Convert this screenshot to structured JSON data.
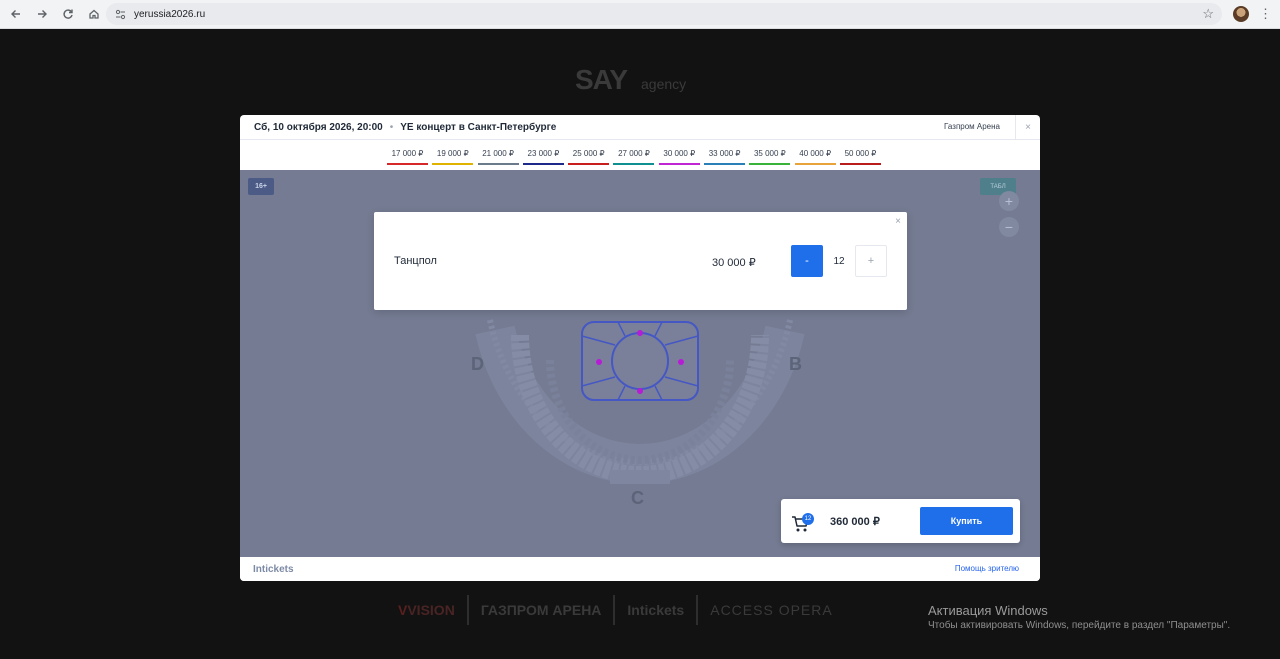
{
  "browser": {
    "url": "yerussia2026.ru",
    "icons": [
      "back-icon",
      "forward-icon",
      "reload-icon",
      "home-icon",
      "site-settings-icon",
      "star-icon",
      "profile-avatar",
      "menu-icon"
    ]
  },
  "background": {
    "logo_main": "SAY",
    "logo_sub": "agency",
    "sponsors": [
      "VISION",
      "ГАЗПРОМ АРЕНА",
      "Intickets",
      "ACCESS OPERA"
    ]
  },
  "modal": {
    "event_date": "Сб, 10 октября 2026, 20:00",
    "separator": "•",
    "event_title": "YE концерт в Санкт-Петербурге",
    "venue": "Газпром Арена",
    "close_glyph": "×",
    "prices": [
      {
        "label": "17 000 ₽",
        "color": "#d62828"
      },
      {
        "label": "19 000 ₽",
        "color": "#e0b300"
      },
      {
        "label": "21 000 ₽",
        "color": "#6b7b8c"
      },
      {
        "label": "23 000 ₽",
        "color": "#1d2a8a"
      },
      {
        "label": "25 000 ₽",
        "color": "#c81e1e"
      },
      {
        "label": "27 000 ₽",
        "color": "#0f8f8f"
      },
      {
        "label": "30 000 ₽",
        "color": "#c026d3"
      },
      {
        "label": "33 000 ₽",
        "color": "#2a7fb8"
      },
      {
        "label": "35 000 ₽",
        "color": "#3bb33b"
      },
      {
        "label": "40 000 ₽",
        "color": "#e8a33a"
      },
      {
        "label": "50 000 ₽",
        "color": "#b91c1c"
      }
    ],
    "map": {
      "age_badge": "16+",
      "zoom_badge": "ТАБЛ",
      "zoom_in": "+",
      "zoom_out": "−",
      "sectors": [
        "D",
        "B",
        "C"
      ]
    },
    "popup": {
      "zone": "Танцпол",
      "price": "30 000 ₽",
      "minus": "-",
      "quantity": "12",
      "plus": "+"
    },
    "cart": {
      "count": "12",
      "total": "360 000 ₽",
      "buy_label": "Купить"
    },
    "footer": {
      "logo": "Intickets",
      "help": "Помощь зрителю"
    }
  },
  "windows": {
    "title": "Активация Windows",
    "text": "Чтобы активировать Windows, перейдите в раздел \"Параметры\"."
  }
}
